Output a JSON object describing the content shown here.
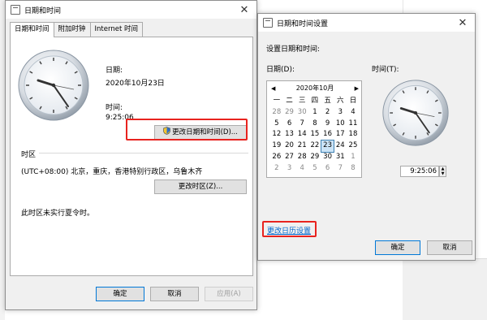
{
  "main_dialog": {
    "title": "日期和时间",
    "close_glyph": "✕",
    "tabs": [
      "日期和时间",
      "附加时钟",
      "Internet 时间"
    ],
    "date_label": "日期:",
    "date_value": "2020年10月23日",
    "time_label": "时间:",
    "time_value": "9:25:06",
    "change_datetime_button": "更改日期和时间(D)...",
    "timezone_group": "时区",
    "timezone_value": "(UTC+08:00) 北京，重庆，香港特别行政区，乌鲁木齐",
    "change_timezone_button": "更改时区(Z)...",
    "dst_note": "此时区未实行夏令时。",
    "ok_button": "确定",
    "cancel_button": "取消",
    "apply_button": "应用(A)"
  },
  "settings_dialog": {
    "title": "日期和时间设置",
    "close_glyph": "✕",
    "header": "设置日期和时间:",
    "date_label": "日期(D):",
    "time_label": "时间(T):",
    "calendar": {
      "month_title": "2020年10月",
      "prev_arrow": "◀",
      "next_arrow": "▶",
      "weekdays": [
        "一",
        "二",
        "三",
        "四",
        "五",
        "六",
        "日"
      ],
      "weeks": [
        [
          "28",
          "29",
          "30",
          "1",
          "2",
          "3",
          "4"
        ],
        [
          "5",
          "6",
          "7",
          "8",
          "9",
          "10",
          "11"
        ],
        [
          "12",
          "13",
          "14",
          "15",
          "16",
          "17",
          "18"
        ],
        [
          "19",
          "20",
          "21",
          "22",
          "23",
          "24",
          "25"
        ],
        [
          "26",
          "27",
          "28",
          "29",
          "30",
          "31",
          "1"
        ],
        [
          "2",
          "3",
          "4",
          "5",
          "6",
          "7",
          "8"
        ]
      ],
      "selected_day": "23"
    },
    "time_value": "9:25:06",
    "change_calendar_link": "更改日历设置",
    "ok_button": "确定",
    "cancel_button": "取消"
  },
  "colors": {
    "highlight_red": "#e8231f",
    "link_blue": "#0066cc",
    "dialog_bg": "#f0f0f0"
  }
}
